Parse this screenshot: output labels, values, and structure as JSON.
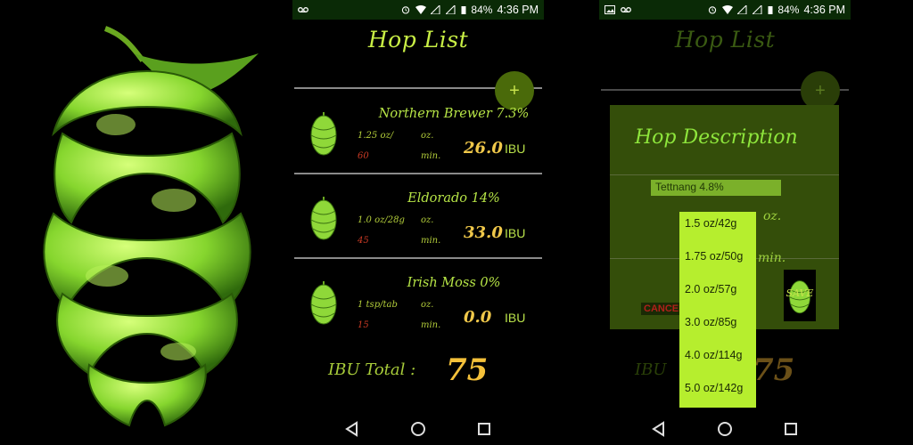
{
  "status_bar": {
    "battery": "84%",
    "time": "4:36 PM"
  },
  "hop_list_screen": {
    "title": "Hop List",
    "add_button": "+",
    "hops": [
      {
        "name": "Northern Brewer 7.3%",
        "amount": "1.25 oz/",
        "minutes": "60",
        "oz_label": "oz.",
        "min_label": "min.",
        "ibu": "26.0",
        "ibu_unit": "IBU"
      },
      {
        "name": "Eldorado 14%",
        "amount": "1.0 oz/28g",
        "minutes": "45",
        "oz_label": "oz.",
        "min_label": "min.",
        "ibu": "33.0",
        "ibu_unit": "IBU"
      },
      {
        "name": "Irish Moss 0%",
        "amount": "1 tsp/tab",
        "minutes": "15",
        "oz_label": "oz.",
        "min_label": "min.",
        "ibu": "0.0",
        "ibu_unit": "IBU"
      }
    ],
    "ibu_total_label": "IBU Total :",
    "ibu_total_value": "75"
  },
  "description_screen": {
    "title": "Hop List",
    "dialog_title": "Hop Description",
    "hop_field_value": "Tettnang 4.8%",
    "oz_label": "oz.",
    "min_label": "min.",
    "cancel_label": "CANCEL",
    "save_label": "SAVE",
    "amount_options": [
      "1.5 oz/42g",
      "1.75 oz/50g",
      "2.0 oz/57g",
      "3.0 oz/85g",
      "4.0 oz/114g",
      "5.0 oz/142g"
    ],
    "ibu_total_label": "IBU",
    "ibu_total_value": "75"
  },
  "nav_icons": [
    "back-icon",
    "home-icon",
    "recents-icon"
  ],
  "colors": {
    "accent_green": "#c9ef45",
    "ibu_yellow": "#f0c84a",
    "minutes_red": "#c93a25",
    "dialog_bg": "#344e0a",
    "dropdown_bg": "#b6ee2e"
  }
}
